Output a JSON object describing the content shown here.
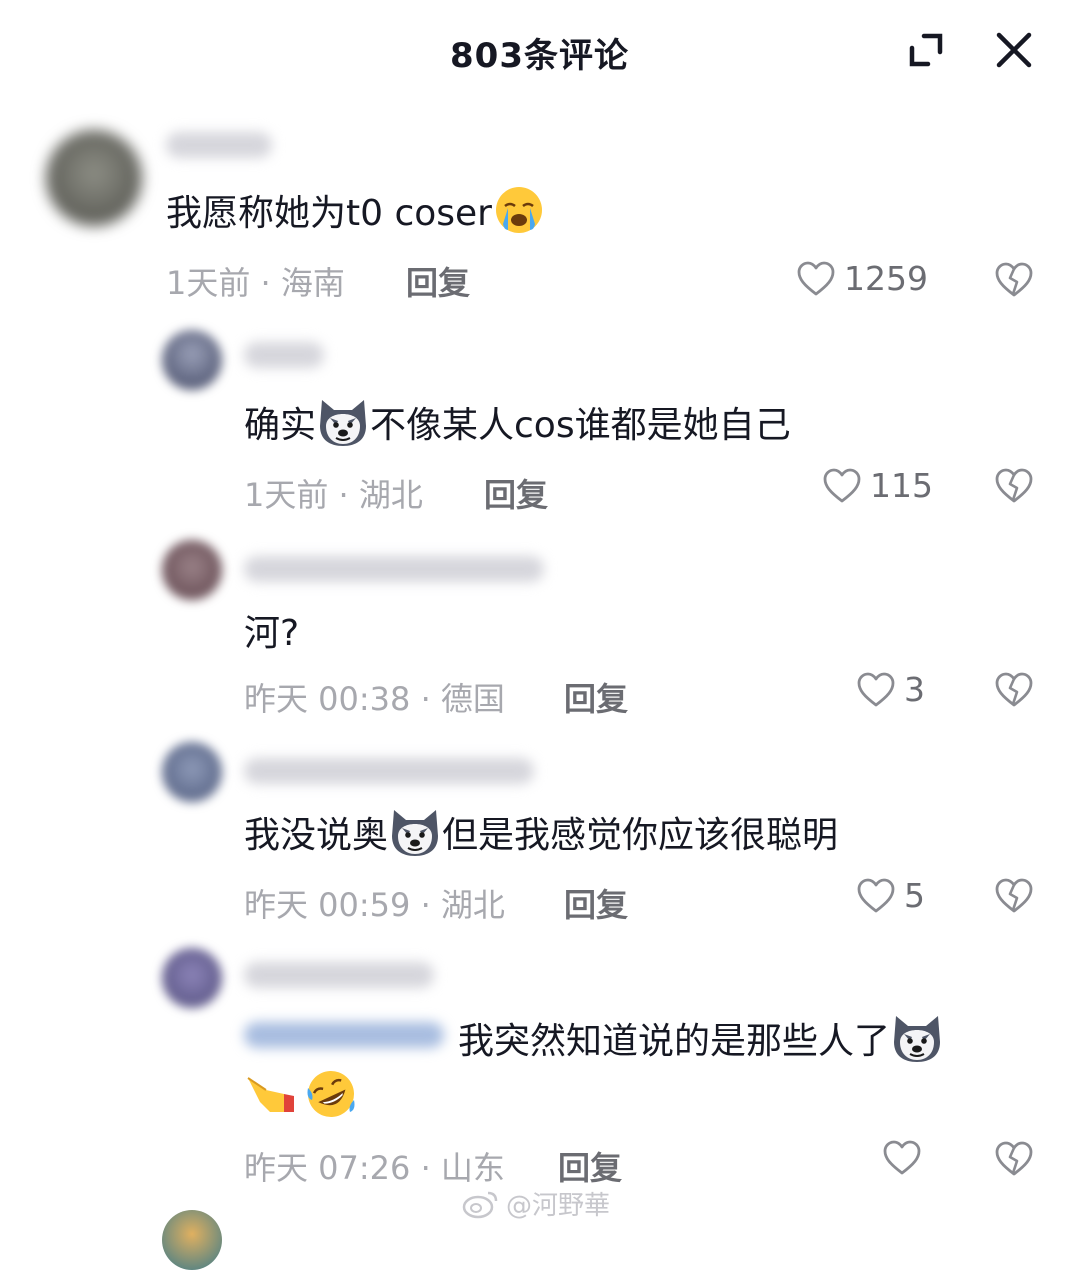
{
  "header": {
    "title": "803条评论",
    "expand_icon": "expand-icon",
    "close_icon": "close-icon"
  },
  "comments": [
    {
      "text": "我愿称她为t0 coser",
      "emoji": [
        "crying-face-emoji"
      ],
      "meta": "1天前 · 海南",
      "reply": "回复",
      "likes": "1259"
    },
    {
      "text_a": "确实",
      "emoji": [
        "husky-dog-emoji"
      ],
      "text_b": "不像某人cos谁都是她自己",
      "meta": "1天前 · 湖北",
      "reply": "回复",
      "likes": "115"
    },
    {
      "text": "河?",
      "meta": "昨天 00:38 · 德国",
      "reply": "回复",
      "likes": "3"
    },
    {
      "text_a": "我没说奥",
      "emoji": [
        "husky-dog-emoji"
      ],
      "text_b": "但是我感觉你应该很聪明",
      "meta": "昨天 00:59 · 湖北",
      "reply": "回复",
      "likes": "5"
    },
    {
      "text": "我突然知道说的是那些人了",
      "emoji": [
        "husky-dog-emoji",
        "pointing-hand-emoji",
        "rolling-laughing-emoji"
      ],
      "meta": "昨天 07:26 · 山东",
      "reply": "回复",
      "likes": ""
    }
  ],
  "watermark": {
    "text": "@河野華",
    "icon": "weibo-icon"
  },
  "colors": {
    "text": "#161823",
    "meta": "#a7a8ae",
    "action": "#6b6c72",
    "mention": "#4a6fa5"
  }
}
